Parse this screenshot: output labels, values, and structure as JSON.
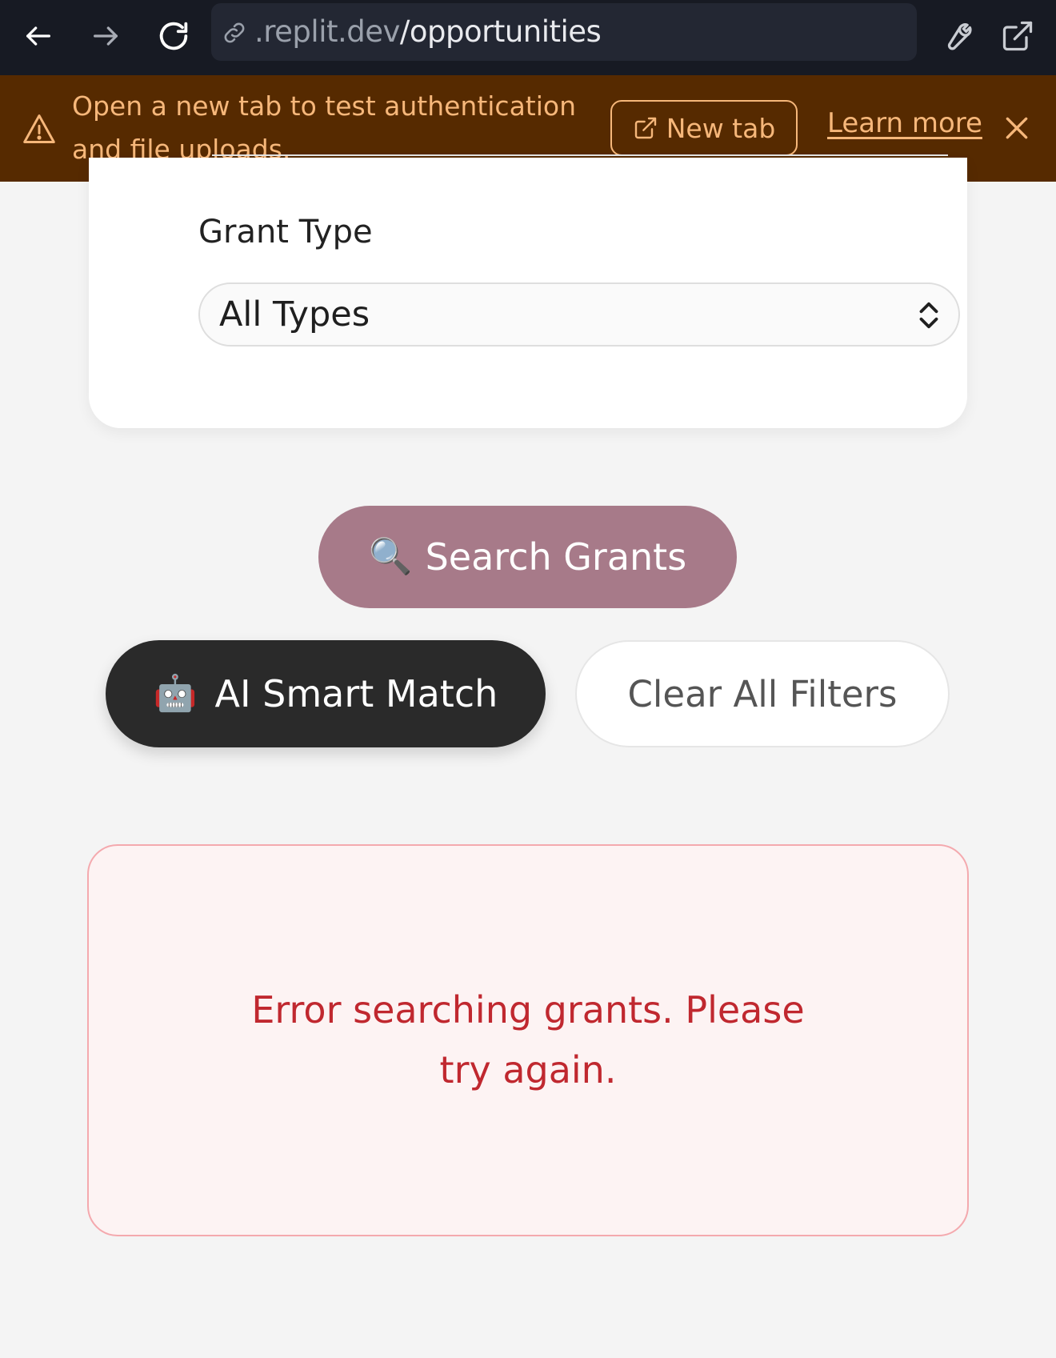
{
  "browser": {
    "url_prefix": ".replit.dev",
    "url_path": "/opportunities"
  },
  "banner": {
    "message": "Open a new tab to test authentication and file uploads.",
    "new_tab_label": "New tab",
    "learn_more_label": "Learn more",
    "accent_color": "#f6b77a",
    "background_color": "#562a00"
  },
  "filters": {
    "grant_type_label": "Grant Type",
    "grant_type_value": "All Types"
  },
  "actions": {
    "search_icon": "🔍",
    "search_label": "Search Grants",
    "ai_icon": "🤖",
    "ai_label": "AI Smart Match",
    "clear_label": "Clear All Filters"
  },
  "results": {
    "error_message": "Error searching grants. Please try again."
  },
  "colors": {
    "search_button": "#a77a89",
    "ai_button": "#2a2a2a",
    "error_text": "#c0282f",
    "error_border": "#f4a9ae"
  }
}
